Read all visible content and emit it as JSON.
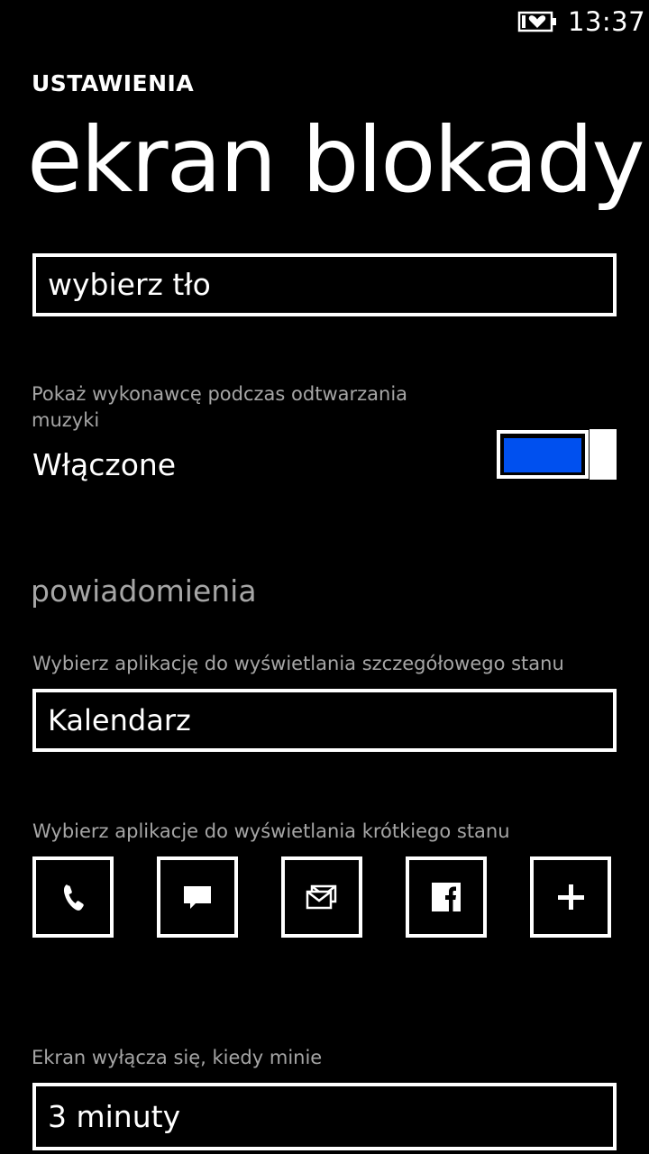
{
  "status_bar": {
    "battery_icon": "battery-saver-heart-icon",
    "time": "13:37"
  },
  "header": {
    "app_title": "USTAWIENIA",
    "page_title": "ekran blokady"
  },
  "background": {
    "button_label": "wybierz tło"
  },
  "artist_toggle": {
    "caption": "Pokaż wykonawcę podczas odtwarzania muzyki",
    "value": "Włączone",
    "state": "on",
    "accent_color": "#0050EF"
  },
  "notifications": {
    "section_title": "powiadomienia",
    "detailed_caption": "Wybierz aplikację do wyświetlania szczegółowego stanu",
    "detailed_value": "Kalendarz",
    "quick_caption": "Wybierz aplikacje do wyświetlania krótkiego stanu",
    "quick_apps": [
      {
        "icon": "phone-icon"
      },
      {
        "icon": "message-icon"
      },
      {
        "icon": "email-icon"
      },
      {
        "icon": "facebook-icon"
      },
      {
        "icon": "plus-icon"
      }
    ]
  },
  "screen_timeout": {
    "caption": "Ekran wyłącza się, kiedy minie",
    "value": "3 minuty"
  }
}
